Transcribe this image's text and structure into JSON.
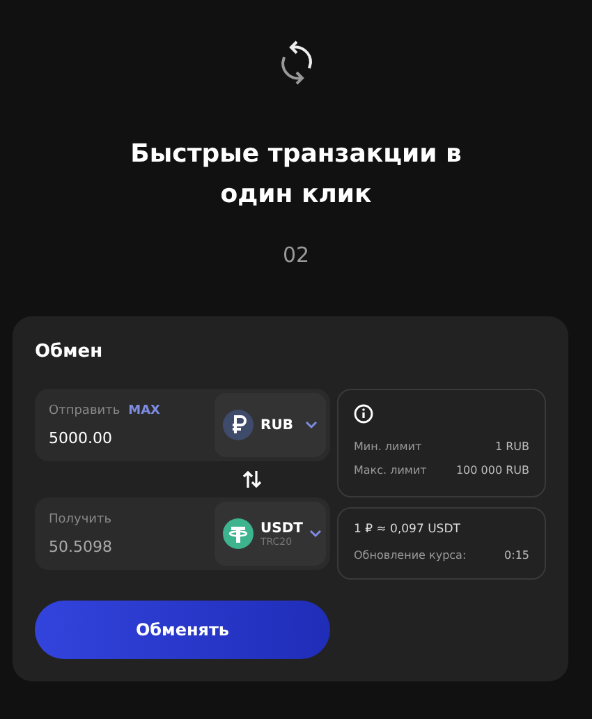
{
  "hero": {
    "title": "Быстрые транзакции в один клик",
    "step": "02"
  },
  "exchange": {
    "title": "Обмен",
    "send": {
      "label": "Отправить",
      "max": "MAX",
      "value": "5000.00",
      "currency": "RUB",
      "kind": "rub"
    },
    "receive": {
      "label": "Получить",
      "value": "50.5098",
      "currency": "USDT",
      "network": "TRC20",
      "kind": "usdt"
    },
    "limits": [
      {
        "label": "Мин. лимит",
        "value": "1 RUB"
      },
      {
        "label": "Макс. лимит",
        "value": "100 000 RUB"
      }
    ],
    "rate": {
      "text": "1 ₽ ≈ 0,097 USDT",
      "label": "Обновление курса:",
      "value": "0:15"
    },
    "button": "Обменять"
  }
}
